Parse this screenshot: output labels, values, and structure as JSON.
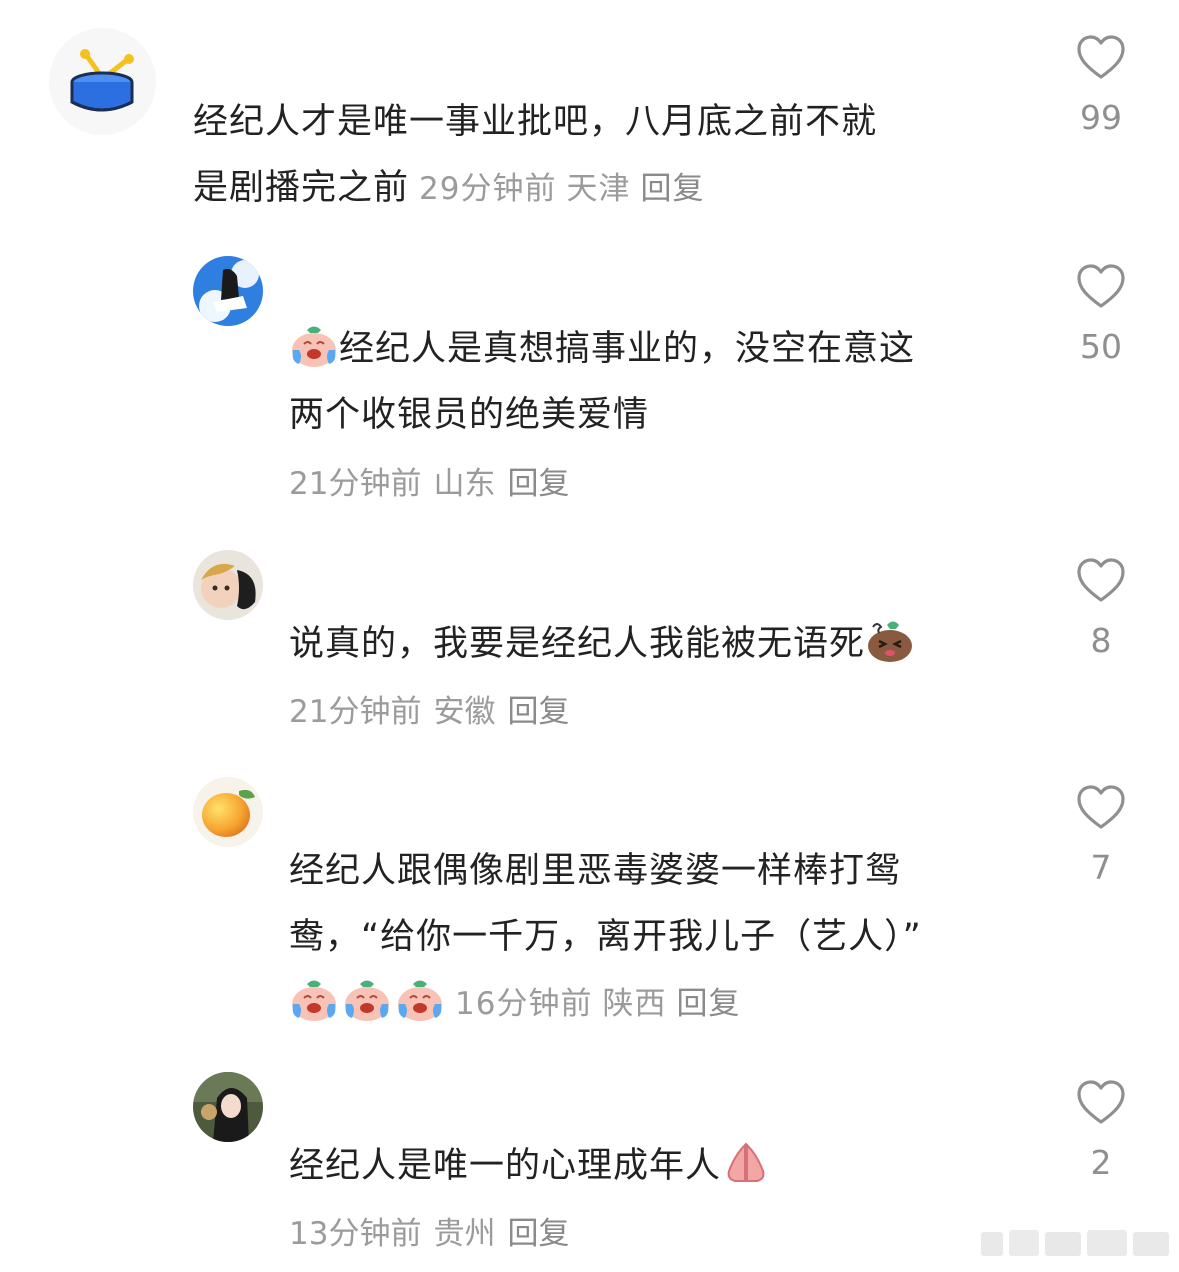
{
  "comments": [
    {
      "text_line1": "经纪人才是唯一事业批吧，八月底之前不就",
      "text_line2": "是剧播完之前",
      "time": "29分钟前",
      "location": "天津",
      "reply": "回复",
      "likes": "99",
      "avatar_icon": "drum-icon"
    },
    {
      "text_line1": "经纪人是真想搞事业的，没空在意这",
      "text_line2": "两个收银员的绝美爱情",
      "time": "21分钟前",
      "location": "山东",
      "reply": "回复",
      "likes": "50",
      "leading_emoji": "crying-laughing-emoji"
    },
    {
      "text_line1": "说真的，我要是经纪人我能被无语死",
      "time": "21分钟前",
      "location": "安徽",
      "reply": "回复",
      "likes": "8",
      "trailing_emoji": "speechless-emoji"
    },
    {
      "text_line1": "经纪人跟偶像剧里恶毒婆婆一样棒打鸳",
      "text_line2": "鸯，“给你一千万，离开我儿子（艺人）”",
      "time": "16分钟前",
      "location": "陕西",
      "reply": "回复",
      "likes": "7",
      "trailing_emoji": "crying-laughing-emoji"
    },
    {
      "text_line1": "经纪人是唯一的心理成年人",
      "time": "13分钟前",
      "location": "贵州",
      "reply": "回复",
      "likes": "2",
      "trailing_emoji": "praying-hands-emoji"
    }
  ],
  "colors": {
    "text": "#222222",
    "meta": "#9b9b9b",
    "like": "#8f8f8f"
  }
}
